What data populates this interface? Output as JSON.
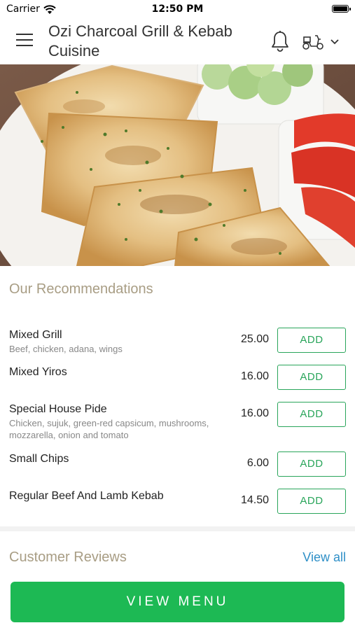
{
  "status_bar": {
    "carrier": "Carrier",
    "time": "12:50 PM"
  },
  "header": {
    "restaurant_name": "Ozi Charcoal Grill & Kebab Cuisine"
  },
  "recommendations": {
    "title": "Our Recommendations",
    "add_label": "ADD",
    "items": [
      {
        "name": "Mixed Grill",
        "description": "Beef, chicken, adana, wings",
        "price": "25.00"
      },
      {
        "name": "Mixed Yiros",
        "description": "",
        "price": "16.00"
      },
      {
        "name": "Special House Pide",
        "description": "Chicken, sujuk, green-red capsicum, mushrooms, mozzarella, onion and tomato",
        "price": "16.00"
      },
      {
        "name": "Small Chips",
        "description": "",
        "price": "6.00"
      },
      {
        "name": "Regular Beef And Lamb Kebab",
        "description": "",
        "price": "14.50"
      }
    ]
  },
  "reviews": {
    "title": "Customer Reviews",
    "view_all": "View all"
  },
  "footer": {
    "view_menu": "VIEW MENU"
  },
  "colors": {
    "accent_green": "#1db954",
    "add_green": "#29a55a",
    "section_title": "#a89d84",
    "link_blue": "#2e8fc7"
  },
  "icons": [
    "wifi-icon",
    "battery-icon",
    "hamburger-menu-icon",
    "bell-icon",
    "scooter-icon",
    "chevron-down-icon"
  ]
}
